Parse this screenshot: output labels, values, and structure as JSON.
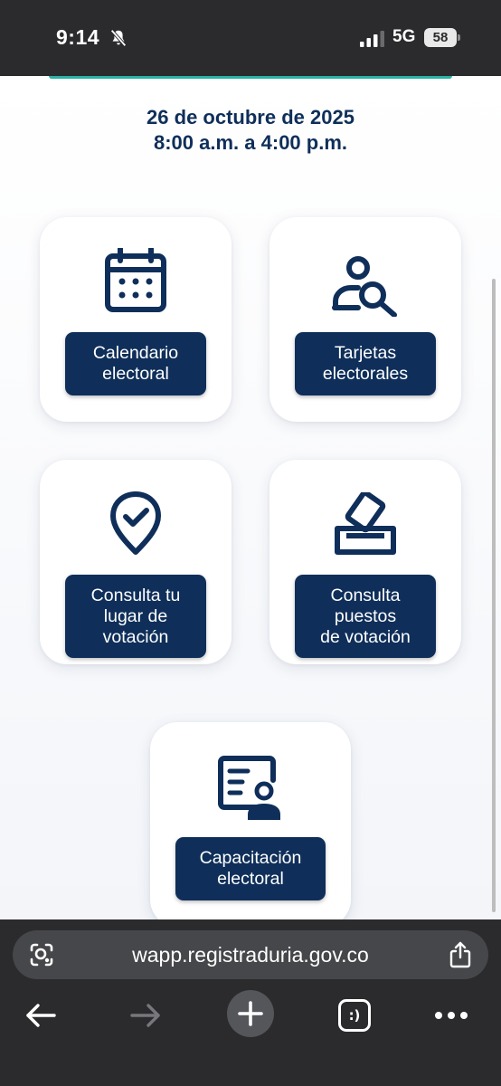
{
  "status_bar": {
    "time": "9:14",
    "network": "5G",
    "battery": "58"
  },
  "schedule": {
    "date": "26 de octubre de 2025",
    "hours": "8:00 a.m. a 4:00 p.m."
  },
  "cards": [
    {
      "icon": "calendar-icon",
      "label_lines": [
        "Calendario",
        "electoral"
      ]
    },
    {
      "icon": "user-search-icon",
      "label_lines": [
        "Tarjetas",
        "electorales"
      ]
    },
    {
      "icon": "location-check-icon",
      "label_lines": [
        "Consulta tu",
        "lugar de",
        "votación"
      ]
    },
    {
      "icon": "ballot-box-icon",
      "label_lines": [
        "Consulta",
        "puestos",
        "de votación"
      ]
    },
    {
      "icon": "id-document-icon",
      "label_lines": [
        "Capacitación",
        "electoral"
      ]
    }
  ],
  "browser": {
    "url": "wapp.registraduria.gov.co",
    "tab_count_glyph": ":)"
  },
  "colors": {
    "primary_navy": "#0f2f5a",
    "accent_teal": "#2bb3a4",
    "chrome_dark": "#2b2b2d"
  }
}
